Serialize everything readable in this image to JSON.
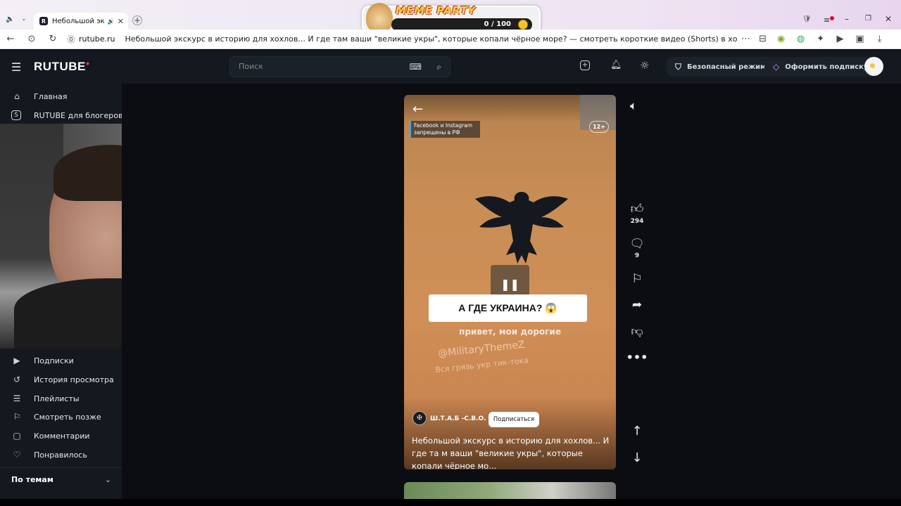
{
  "browser": {
    "tab_title": "Небольшой экскурс",
    "url_domain": "rutube.ru",
    "page_title": "Небольшой экскурс в историю для хохлов... И где там ваши \"великие укры\", которые копали чёрное море? — смотреть короткие видео (Shorts) в хорошем качестве и бесплатно на RUT...",
    "meme_party": {
      "title": "MEME PARTY",
      "progress_text": "0 / 100",
      "progress_value": 0
    }
  },
  "header": {
    "logo": "RUTUBE",
    "search_placeholder": "Поиск",
    "safe_mode": "Безопасный режим",
    "subscribe": "Оформить подписку"
  },
  "sidebar": {
    "top_items": [
      {
        "label": "Главная",
        "icon": "home-icon"
      },
      {
        "label": "RUTUBE для блогеров",
        "icon": "studio-icon"
      }
    ],
    "items": [
      {
        "label": "Подписки",
        "icon": "subscriptions-icon"
      },
      {
        "label": "История просмотра",
        "icon": "history-icon"
      },
      {
        "label": "Плейлисты",
        "icon": "playlist-icon"
      },
      {
        "label": "Смотреть позже",
        "icon": "bookmark-icon"
      },
      {
        "label": "Комментарии",
        "icon": "comment-icon"
      },
      {
        "label": "Понравилось",
        "icon": "like-icon"
      }
    ],
    "topics": "По темам"
  },
  "video": {
    "age_rating": "12+",
    "disclaimer": "Facebook и Instagram запрещены в РФ",
    "overlay_caption": "А ГДЕ УКРАИНА? 😱",
    "overlay_subtext": "привет, мои дорогие",
    "watermark1": "@MilitaryThemeZ",
    "watermark2": "Вся грязь укр тик-тока",
    "channel": "Ш.Т.А.Б -С.В.О. РФ",
    "subscribe_button": "Подписаться",
    "description": "Небольшой экскурс в историю для хохлов... И где та м ваши \"великие укры\", которые копали чёрное мо..."
  },
  "actions": {
    "likes": "294",
    "comments": "9"
  }
}
